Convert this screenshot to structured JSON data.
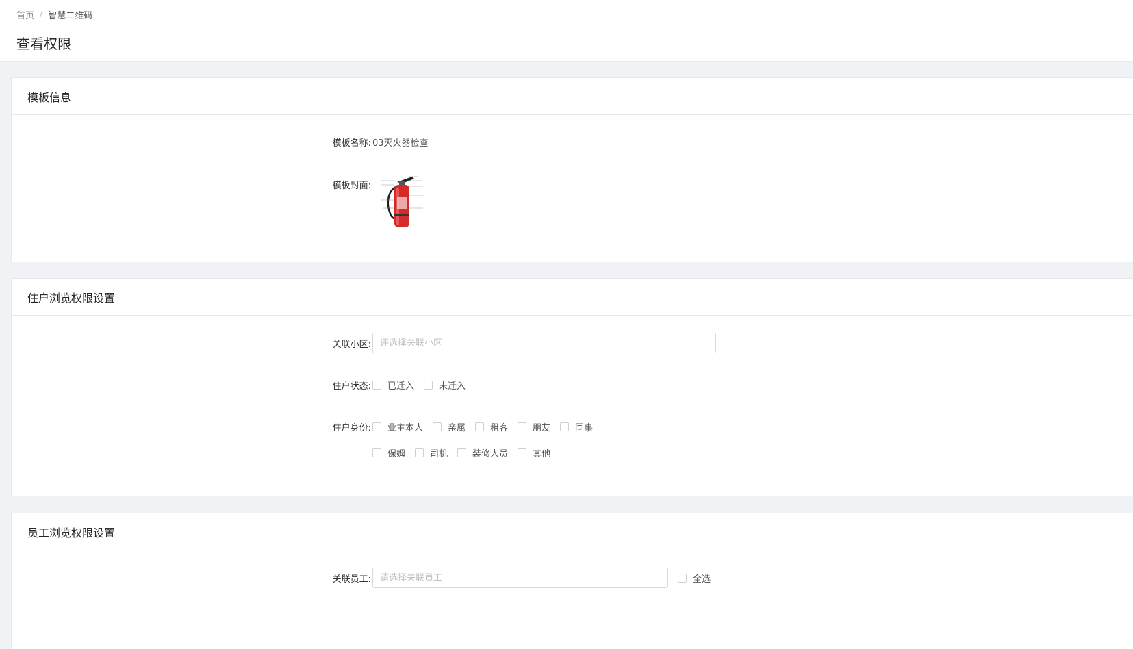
{
  "breadcrumb": {
    "home": "首页",
    "separator": "/",
    "current": "智慧二维码"
  },
  "page_title": "查看权限",
  "template_info": {
    "section_title": "模板信息",
    "name_label": "模板名称:",
    "name_value": "03灭火器检查",
    "cover_label": "模板封面:",
    "cover_icon": "fire-extinguisher-image"
  },
  "resident_settings": {
    "section_title": "住户浏览权限设置",
    "community_label": "关联小区:",
    "community_placeholder": "评选择关联小区",
    "status_label": "住户状态:",
    "status_options": [
      "已迁入",
      "未迁入"
    ],
    "identity_label": "住户身份:",
    "identity_options_row1": [
      "业主本人",
      "亲属",
      "租客",
      "朋友",
      "同事"
    ],
    "identity_options_row2": [
      "保姆",
      "司机",
      "装修人员",
      "其他"
    ]
  },
  "staff_settings": {
    "section_title": "员工浏览权限设置",
    "staff_label": "关联员工:",
    "staff_placeholder": "请选择关联员工",
    "select_all": "全选"
  },
  "colors": {
    "background": "#f0f2f5",
    "extinguisher": "#d42a2a",
    "border": "#d9d9d9"
  }
}
